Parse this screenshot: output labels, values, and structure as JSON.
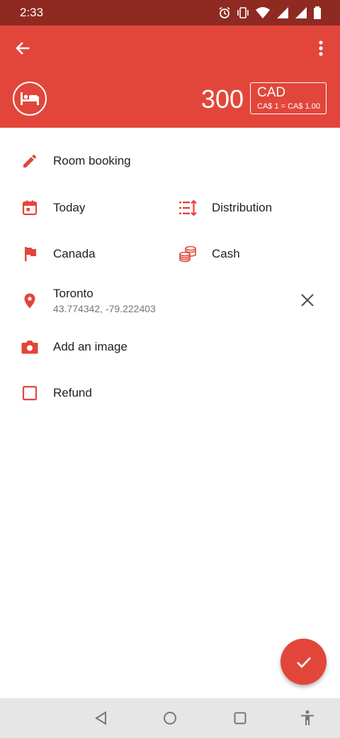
{
  "status_bar": {
    "time": "2:33"
  },
  "header": {
    "amount": "300",
    "currency_code": "CAD",
    "currency_rate": "CA$ 1 = CA$ 1.00",
    "category_icon": "bed-icon"
  },
  "form": {
    "title": "Room booking",
    "date": "Today",
    "distribution": "Distribution",
    "country": "Canada",
    "payment": "Cash",
    "location_name": "Toronto",
    "location_coords": "43.774342, -79.222403",
    "add_image": "Add an image",
    "refund": "Refund"
  },
  "colors": {
    "accent": "#e2463b",
    "status_bar": "#8e2a22",
    "navbar": "#e6e6e6"
  }
}
